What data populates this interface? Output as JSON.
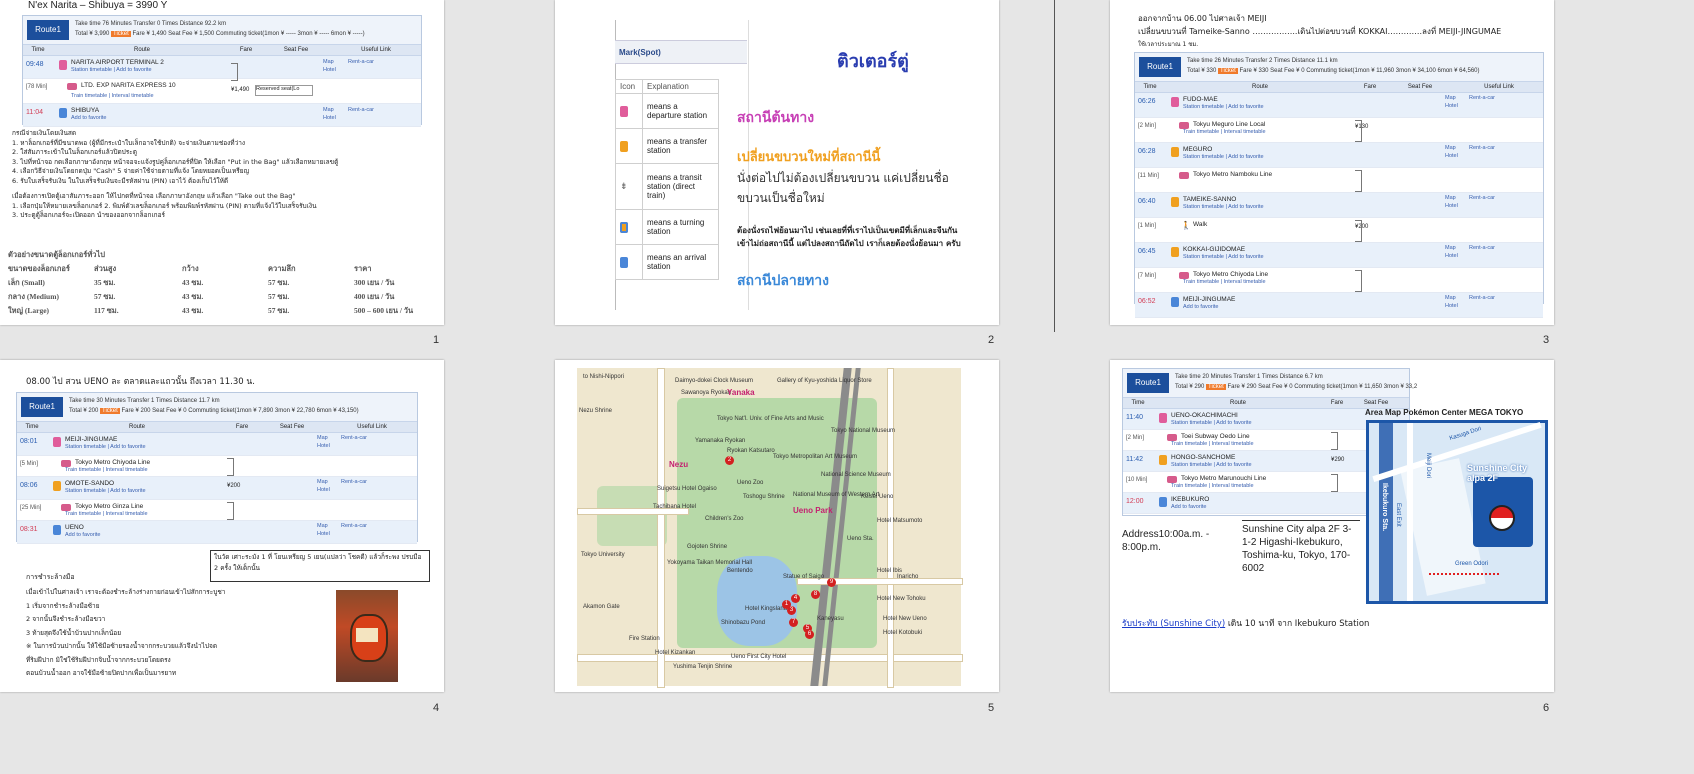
{
  "slides": [
    {
      "number": "1",
      "title": "N'ex  Narita – Shibuya = 3990 Y",
      "route": {
        "badge": "Route1",
        "info1": "Take time  76 Minutes  Transfer  0 Times  Distance  92.2 km",
        "info2_prefix": "Total ¥ 3,990",
        "ticket": "Ticket",
        "info2_suffix": "Fare ¥ 1,490  Seat Fee ¥ 1,500  Commuting ticket(1mon ¥ -----   3mon ¥ -----   6mon ¥ -----)",
        "cols": [
          "Time",
          "Route",
          "Fare",
          "Seat Fee",
          "Useful Link"
        ],
        "rows": [
          {
            "time": "09:48",
            "name": "NARITA AIRPORT TERMINAL 2",
            "sub": "Station timetable | Add to favorite"
          },
          {
            "time": "[78 Min]",
            "name": "LTD. EXP NARITA EXPRESS 10",
            "sub": "Train timetable | Interval timetable",
            "fare": "¥1,490",
            "seat": "Reserved seat(Lo"
          },
          {
            "time": "11:04",
            "name": "SHIBUYA",
            "sub": "Add to favorite"
          }
        ],
        "links": [
          "Map",
          "Rent-a-car",
          "Hotel"
        ]
      },
      "notes_title": "กรณีจ่ายเงินโดยเงินสด",
      "notes": [
        "1. หาล็อกเกอร์ที่มีขนาดพอ (ผู้ที่มีกระเป๋าใบเล็กอาจใช้ปกติ) จะจ่ายเงินตามช่องที่ว่าง",
        "2. ใส่สัมภาระเข้าในในล็อกเกอร์แล้วปิดประตู",
        "3. ไปที่หน้าจอ กดเลือกภาษาอังกฤษ หน้าจอจะแจ้งรูปคู่ล็อกเกอร์ที่ปิด ให้เลือก \"Put in the Bag\" แล้วเลือกหมายเลขตู้",
        "4. เลือกวิธีจ่ายเงินโดยกดปุ่ม \"Cash\"          5 จ่ายค่าใช้จ่ายตามที่แจ้ง โดยหยอดเป็นเหรียญ",
        "6. รับใบเสร็จรับเงิน ในใบเสร็จรับเงินจะมีรหัสผ่าน (PIN) เอาไว้ ต้องเก็บไว้ให้ดี"
      ],
      "notes2": [
        "     เมื่อต้องการเปิดตู้เอาสัมภาระออก ให้ไปกดที่หน้าจอ เลือกภาษาอังกฤษ แล้วเลือก \"Take out the Bag\"",
        "1. เลือกปุ่มให้หมายเลขล็อกเกอร์    2. พิมพ์ตัวเลขล็อกเกอร์ พร้อมพิมพ์รหัสผ่าน (PIN) ตามที่แจ้งไว้ใบเสร็จรับเงิน",
        "3. ประตูตู้ล็อกเกอร์จะเปิดออก   นำของออกจากล็อกเกอร์"
      ],
      "size_title": "ตัวอย่างขนาดตู้ล็อกเกอร์ทั่วไป",
      "size_table": {
        "head": [
          "ขนาดของล็อกเกอร์",
          "ส่วนสูง",
          "กว้าง",
          "ความลึก",
          "ราคา"
        ],
        "rows": [
          [
            "เล็ก (Small)",
            "35  ซม.",
            "43  ซม.",
            "57  ซม.",
            "300  เยน  / วัน"
          ],
          [
            "กลาง (Medium)",
            "57  ซม.",
            "43  ซม.",
            "57  ซม.",
            "400  เยน  / วัน"
          ],
          [
            "ใหญ่ (Large)",
            "117  ซม.",
            "43  ซม.",
            "57  ซม.",
            "500 – 600  เยน  / วัน"
          ]
        ]
      }
    },
    {
      "number": "2",
      "mark_label": "Mark(Spot)",
      "legend_head": [
        "Icon",
        "Explanation"
      ],
      "legend": [
        "means a departure station",
        "means a transfer station",
        "means a transit station (direct train)",
        "means a turning station",
        "means an arrival station"
      ],
      "heading": "ติวเตอร์ตู่",
      "depart": "สถานีต้นทาง",
      "transfer": "เปลี่ยนขบวนใหม่ที่สถานีนี้",
      "transit": "นั่งต่อไปไม่ต้องเปลี่ยนขบวน แค่เปลี่ยนชื่อขบวนเป็นชื่อใหม่",
      "turn": "ต้องนั่งรถไฟย้อนมาไป เช่นเลยที่ที่เราไปเป็นเขตมีที่เล็กและจีนกัน เข้าไม่ถ่อสถานีนี้ แต่ไปลงสถานีถัดไป เราก็เลยต้องนั่งย้อนมา ครับ",
      "arrive": "สถานีปลายทาง"
    },
    {
      "number": "3",
      "line1": "ออกจากบ้าน 06.00 ไปศาลเจ้า  MEIJI",
      "line2": "เปลี่ยนขบวนที่ Tameike-Sanno ……………..เดินไปต่อขบวนที่ KOKKAI………….ลงที่ MEIJI-JINGUMAE",
      "line3": "ใช้เวลาประมาณ  1  ชม.",
      "route": {
        "badge": "Route1",
        "info1": "Take time  26 Minutes  Transfer  2 Times  Distance  11.1 km",
        "info2_prefix": "Total ¥ 330",
        "ticket": "Ticket",
        "info2_suffix": "Fare ¥ 330  Seat Fee ¥ 0  Commuting ticket(1mon ¥ 11,960  3mon ¥ 34,100  6mon ¥ 64,560)",
        "cols": [
          "Time",
          "Route",
          "Fare",
          "Seat Fee",
          "Useful Link"
        ],
        "rows": [
          {
            "time": "06:26",
            "name": "FUDO-MAE",
            "sub": "Station timetable | Add to favorite",
            "kind": "st"
          },
          {
            "time": "[2 Min]",
            "name": "Tokyu Meguro Line Local",
            "sub": "Train timetable | Interval timetable",
            "fare": "¥130",
            "kind": "ride"
          },
          {
            "time": "06:28",
            "name": "MEGURO",
            "sub": "Station timetable | Add to favorite",
            "kind": "st"
          },
          {
            "time": "[11 Min]",
            "name": "Tokyo Metro Namboku Line",
            "sub": "",
            "kind": "ride"
          },
          {
            "time": "06:40",
            "name": "TAMEIKE-SANNO",
            "sub": "Station timetable | Add to favorite",
            "kind": "st"
          },
          {
            "time": "[1 Min]",
            "name": "Walk",
            "sub": "",
            "fare": "¥200",
            "kind": "walk"
          },
          {
            "time": "06:45",
            "name": "KOKKAI-GIJIDOMAE",
            "sub": "Station timetable | Add to favorite",
            "kind": "st"
          },
          {
            "time": "[7 Min]",
            "name": "Tokyo Metro Chiyoda Line",
            "sub": "Train timetable | Interval timetable",
            "kind": "ride"
          },
          {
            "time": "06:52",
            "name": "MEIJI-JINGUMAE",
            "sub": "Add to favorite",
            "kind": "st"
          }
        ],
        "links": [
          "Map",
          "Rent-a-car",
          "Hotel"
        ]
      }
    },
    {
      "number": "4",
      "title": "08.00  ไป สวน  UENO  ละ ตลาดและแถวนั้น ถึงเวลา 11.30 น.",
      "route": {
        "badge": "Route1",
        "info1": "Take time  30 Minutes  Transfer  1 Times  Distance  11.7 km",
        "info2_prefix": "Total ¥ 200",
        "ticket": "Ticket",
        "info2_suffix": "Fare ¥ 200  Seat Fee ¥ 0  Commuting ticket(1mon ¥ 7,890  3mon ¥ 22,780  6mon ¥ 43,150)",
        "cols": [
          "Time",
          "Route",
          "Fare",
          "Seat Fee",
          "Useful Link"
        ],
        "rows": [
          {
            "time": "08:01",
            "name": "MEIJI-JINGUMAE",
            "sub": "Station timetable | Add to favorite",
            "kind": "st"
          },
          {
            "time": "[5 Min]",
            "name": "Tokyo Metro Chiyoda Line",
            "sub": "Train timetable | Interval timetable",
            "kind": "ride"
          },
          {
            "time": "08:06",
            "name": "OMOTE-SANDO",
            "sub": "Station timetable | Add to favorite",
            "fare": "¥200",
            "kind": "st"
          },
          {
            "time": "[25 Min]",
            "name": "Tokyo Metro Ginza Line",
            "sub": "Train timetable | Interval timetable",
            "kind": "ride"
          },
          {
            "time": "08:31",
            "name": "UENO",
            "sub": "Add to favorite",
            "kind": "st"
          }
        ],
        "links": [
          "Map",
          "Rent-a-car",
          "Hotel"
        ]
      },
      "boxnote": "ในวัด เศาะระมัง 1 ที่ โยนเหรียญ 5 เยน(แปลว่า โชคดี) แล้วก็ระพง ปรบมือ 2 ครั้ง ให้เด็กนั้น",
      "temple_title": "การชำระล้างมือ",
      "temple": [
        "เมื่อเข้าไปในศาลเจ้า เราจะต้องชำระล้างร่างกายก่อนเข้าไปสักการะบูชา",
        "1 เริ่มจากชำระล้างมือซ้าย",
        "2 จากนั้นจึงชำระล้างมือขวา",
        "3 ท้ายสุดจึงใช้น้ำบ้วนปากเล็กน้อย",
        "※ ในการบ้วนปากนั้น ให้ใช้มือซ้ายรองน้ำจากกระบวยแล้วจึงนำไปจด",
        "ที่ริมฝีปาก มิใช่ใช้ริมฝีปากจิบน้ำจากกระบวยโดยตรง",
        "ตอนบ้วนน้ำออก อาจใช้มือซ้ายปิดปากเพื่อเป็นมารยาท"
      ]
    },
    {
      "number": "5",
      "labels": [
        "to Nishi-Nippori",
        "Daimyo-dokei Clock Museum",
        "Sawanoya Ryokan",
        "Yanaka",
        "Gallery of Kyu-yoshida Liquor Store",
        "Nezu Shrine",
        "Tokyo Nat'l. Univ. of Fine Arts and Music",
        "Tokyo National Museum",
        "Nezu",
        "Ryokan Katsutaro",
        "Yamanaka Ryokan",
        "Tokyo Metropolitan Art Museum",
        "Ueno Zoo",
        "Toshogu Shrine",
        "National Museum of Western Art",
        "National Science Museum",
        "Ueno Park",
        "Hotel Matsumoto",
        "Yokoyama Taikan Memorial Hall",
        "Bentendo",
        "Shinobazu Pond",
        "Statue of Saigo",
        "Hotel Ibis",
        "Hotel New Ueno",
        "Tokyo University",
        "Akamon Gate",
        "Fire Station",
        "Hotel Kizankan",
        "Yushima Tenjin Shrine",
        "Hotel New Tohoku",
        "Kaneyasu",
        "Suigetsu Hotel Ogaiso",
        "Tachibana Hotel",
        "Children's Zoo",
        "Gojoten Shrine",
        "Ueno First City Hotel",
        "Hotel Kingsland",
        "Ueno Sta.",
        "Inaricho",
        "Hotel Kotobuki",
        "Keisei Ueno"
      ],
      "pins": [
        "1",
        "2",
        "3",
        "4",
        "5",
        "6",
        "7",
        "8",
        "9"
      ]
    },
    {
      "number": "6",
      "route": {
        "badge": "Route1",
        "info1": "Take time  20 Minutes  Transfer  1 Times  Distance  6.7 km",
        "info2_prefix": "Total ¥ 290",
        "ticket": "Ticket",
        "info2_suffix": "Fare ¥ 290  Seat Fee ¥ 0  Commuting ticket(1mon ¥ 11,650  3mon ¥ 33,2",
        "cols": [
          "Time",
          "Route",
          "Fare",
          "Seat Fee",
          "Useful Link"
        ],
        "rows": [
          {
            "time": "11:40",
            "name": "UENO-OKACHIMACHI",
            "sub": "Station timetable | Add to favorite",
            "kind": "st"
          },
          {
            "time": "[2 Min]",
            "name": "Toei Subway Oedo Line",
            "sub": "Train timetable | Interval timetable",
            "kind": "ride"
          },
          {
            "time": "11:42",
            "name": "HONGO-SANCHOME",
            "sub": "Station timetable | Add to favorite",
            "fare": "¥290",
            "kind": "st"
          },
          {
            "time": "[10 Min]",
            "name": "Tokyo Metro Marunouchi Line",
            "sub": "Train timetable | Interval timetable",
            "kind": "ride"
          },
          {
            "time": "12:00",
            "name": "IKEBUKURO",
            "sub": "Add to favorite",
            "kind": "st"
          }
        ]
      },
      "address_label": "Address10:00a.m. - 8:00p.m.",
      "address": "Sunshine City alpa 2F 3-1-2 Higashi-Ikebukuro, Toshima-ku, Tokyo, 170-6002",
      "area_title": "Area Map Pokémon Center MEGA TOKYO",
      "area_labels": [
        "Sunshine City alpa 2F",
        "Ikebukuro Sta.",
        "Kasuga Dori",
        "Meiji Dori",
        "East Exit",
        "Green Odori"
      ],
      "link": "รับประทับ (Sunshine City)",
      "link_suffix": " เดิน 10 นาที จาก Ikebukuro Station"
    }
  ]
}
